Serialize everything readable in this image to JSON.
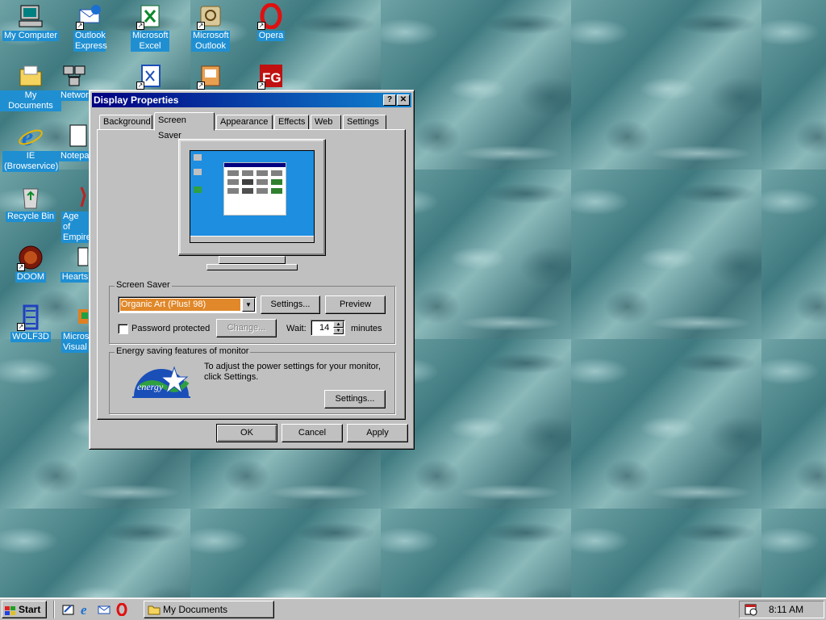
{
  "desktop": {
    "icons": [
      {
        "label": "My Computer",
        "icon": "my-computer-icon",
        "shortcut": false
      },
      {
        "label": "Outlook Express",
        "icon": "outlook-express-icon",
        "shortcut": true
      },
      {
        "label": "Microsoft Excel",
        "icon": "excel-icon",
        "shortcut": true
      },
      {
        "label": "Microsoft Outlook",
        "icon": "outlook-icon",
        "shortcut": true
      },
      {
        "label": "Opera",
        "icon": "opera-icon",
        "shortcut": true
      },
      {
        "label": "My Documents",
        "icon": "folder-icon",
        "shortcut": false
      },
      {
        "label": "Network Neighborhood",
        "icon": "network-icon",
        "shortcut": false
      },
      {
        "label": "IE (Browservice)",
        "icon": "internet-explorer-icon",
        "shortcut": false
      },
      {
        "label": "Notepad",
        "icon": "notepad-icon",
        "shortcut": true
      },
      {
        "label": "Recycle Bin",
        "icon": "recycle-bin-icon",
        "shortcut": false
      },
      {
        "label": "Age of Empires",
        "icon": "age-of-empires-icon",
        "shortcut": true
      },
      {
        "label": "DOOM",
        "icon": "doom-icon",
        "shortcut": true
      },
      {
        "label": "Hearts",
        "icon": "hearts-icon",
        "shortcut": true
      },
      {
        "label": "WOLF3D",
        "icon": "wolf3d-icon",
        "shortcut": true
      },
      {
        "label": "Microsoft Visual",
        "icon": "visual-studio-icon",
        "shortcut": true
      }
    ]
  },
  "dialog": {
    "title": "Display Properties",
    "help_label": "?",
    "close_label": "✕",
    "tabs": [
      "Background",
      "Screen Saver",
      "Appearance",
      "Effects",
      "Web",
      "Settings"
    ],
    "active_tab": "Screen Saver",
    "screen_saver": {
      "group_label": "Screen Saver",
      "selected": "Organic Art (Plus! 98)",
      "settings_label": "Settings...",
      "preview_label": "Preview",
      "password_label": "Password protected",
      "password_checked": false,
      "change_label": "Change...",
      "wait_label": "Wait:",
      "wait_value": "14",
      "minutes_label": "minutes"
    },
    "energy": {
      "group_label": "Energy saving features of monitor",
      "text": "To adjust the power settings for your monitor, click Settings.",
      "settings_label": "Settings...",
      "logo_text": "energy"
    },
    "ok_label": "OK",
    "cancel_label": "Cancel",
    "apply_label": "Apply"
  },
  "taskbar": {
    "start_label": "Start",
    "quick_launch": [
      "show-desktop-icon",
      "internet-explorer-icon",
      "outlook-express-icon",
      "opera-icon"
    ],
    "task_label": "My Documents",
    "clock": "8:11 AM"
  },
  "colors": {
    "face": "#c0c0c0",
    "title_start": "#000080",
    "title_end": "#1084d0",
    "selection": "#1f8fd2",
    "preview_desktop": "#1e8ee0"
  }
}
